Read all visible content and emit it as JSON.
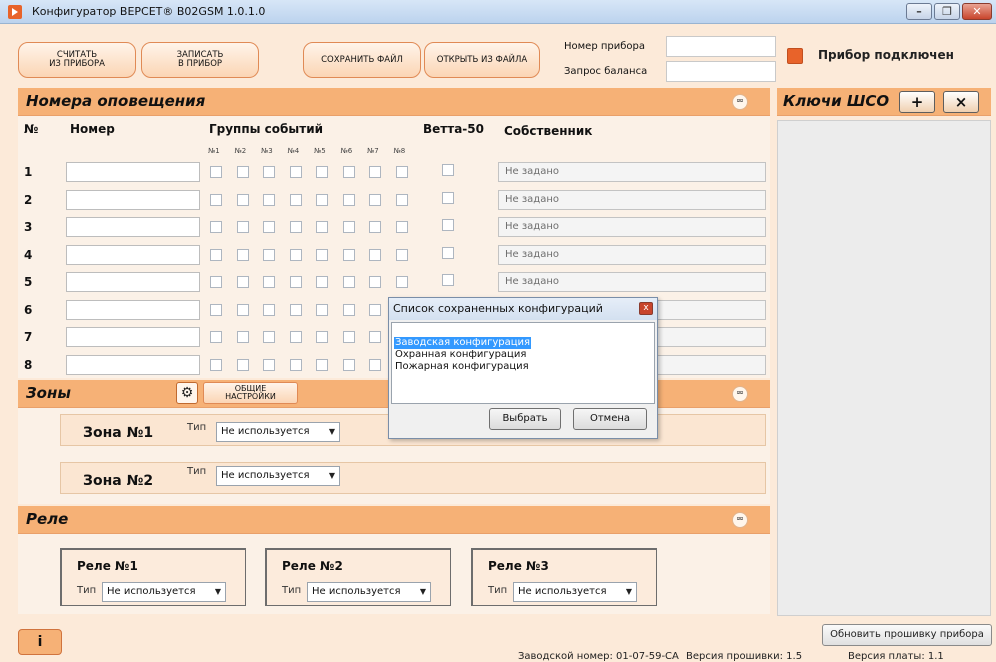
{
  "window": {
    "title": "Конфигуратор ВЕРСЕТ® В02GSM 1.0.1.0",
    "minimize": "–",
    "maximize": "❐",
    "close": "✕"
  },
  "toolbar": {
    "read_line1": "СЧИТАТЬ",
    "read_line2": "ИЗ ПРИБОРА",
    "write_line1": "ЗАПИСАТЬ",
    "write_line2": "В ПРИБОР",
    "save_file": "СОХРАНИТЬ ФАЙЛ",
    "open_file": "ОТКРЫТЬ ИЗ ФАЙЛА",
    "device_number_label": "Номер прибора",
    "device_number_value": "",
    "balance_label": "Запрос баланса",
    "balance_value": "",
    "connected_label": "Прибор подключен",
    "connected_color": "#e8632a"
  },
  "notify": {
    "title": "Номера оповещения",
    "col_num": "№",
    "col_number": "Номер",
    "col_groups": "Группы событий",
    "col_vetta": "Ветта-50",
    "col_owner": "Собственник",
    "group_labels": [
      "№1",
      "№2",
      "№3",
      "№4",
      "№5",
      "№6",
      "№7",
      "№8"
    ],
    "rows": [
      {
        "n": "1",
        "number": "",
        "owner": "Не задано"
      },
      {
        "n": "2",
        "number": "",
        "owner": "Не задано"
      },
      {
        "n": "3",
        "number": "",
        "owner": "Не задано"
      },
      {
        "n": "4",
        "number": "",
        "owner": "Не задано"
      },
      {
        "n": "5",
        "number": "",
        "owner": "Не задано"
      },
      {
        "n": "6",
        "number": "",
        "owner": ""
      },
      {
        "n": "7",
        "number": "",
        "owner": ""
      },
      {
        "n": "8",
        "number": "",
        "owner": ""
      }
    ]
  },
  "zones": {
    "title": "Зоны",
    "settings_line1": "ОБЩИЕ",
    "settings_line2": "НАСТРОЙКИ",
    "items": [
      {
        "label": "Зона №1",
        "type_label": "Тип",
        "type_value": "Не используется"
      },
      {
        "label": "Зона №2",
        "type_label": "Тип",
        "type_value": "Не используется"
      }
    ]
  },
  "relays": {
    "title": "Реле",
    "items": [
      {
        "label": "Реле №1",
        "type_label": "Тип",
        "type_value": "Не используется"
      },
      {
        "label": "Реле №2",
        "type_label": "Тип",
        "type_value": "Не используется"
      },
      {
        "label": "Реле №3",
        "type_label": "Тип",
        "type_value": "Не используется"
      }
    ]
  },
  "keys": {
    "title": "Ключи ШСО",
    "add": "+",
    "remove": "×"
  },
  "dialog": {
    "title": "Список сохраненных конфигураций",
    "close": "x",
    "items": [
      "Заводская конфигурация",
      "Охранная конфигурация",
      "Пожарная конфигурация"
    ],
    "selected_index": 0,
    "choose": "Выбрать",
    "cancel": "Отмена"
  },
  "footer": {
    "info": "i",
    "update_firmware": "Обновить прошивку прибора",
    "serial": "Заводской номер: 01-07-59-СА",
    "firmware": "Версия прошивки: 1.5",
    "board": "Версия платы: 1.1"
  }
}
